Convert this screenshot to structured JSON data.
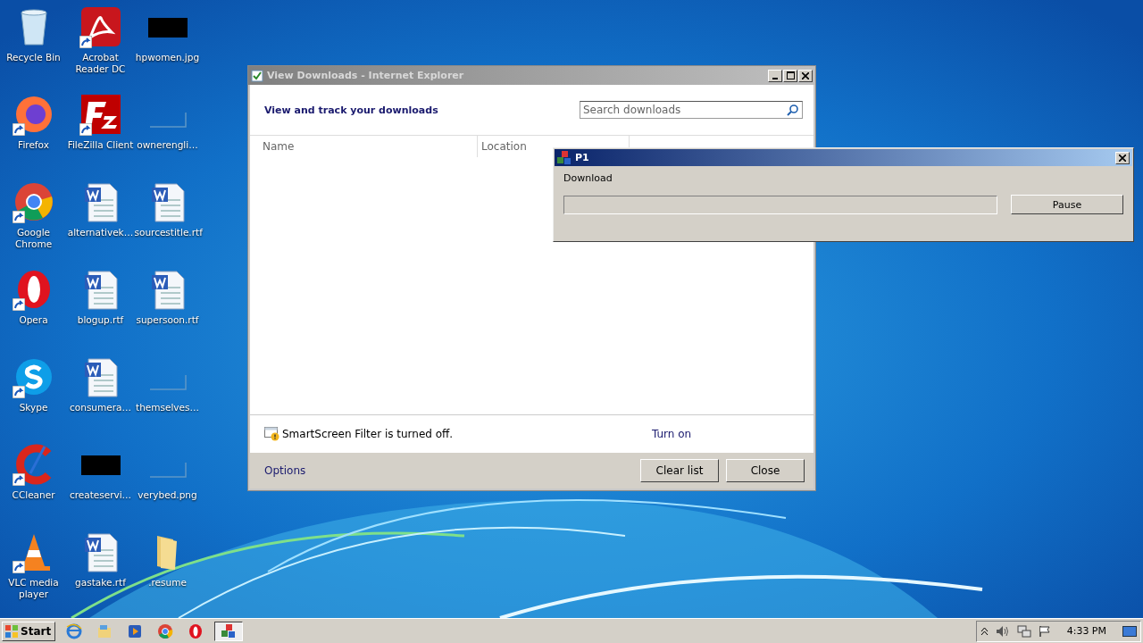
{
  "desktop_icons": [
    {
      "label": "Recycle Bin",
      "kind": "recycle",
      "shortcut": false
    },
    {
      "label": "Acrobat Reader DC",
      "kind": "pdf",
      "shortcut": true
    },
    {
      "label": "hpwomen.jpg",
      "kind": "dark-thumb",
      "shortcut": false
    },
    {
      "label": "Firefox",
      "kind": "firefox",
      "shortcut": true
    },
    {
      "label": "FileZilla Client",
      "kind": "filezilla",
      "shortcut": true
    },
    {
      "label": "ownerengli…",
      "kind": "blank-thumb",
      "shortcut": false
    },
    {
      "label": "Google Chrome",
      "kind": "chrome",
      "shortcut": true
    },
    {
      "label": "alternativek…",
      "kind": "word",
      "shortcut": false
    },
    {
      "label": "sourcestitle.rtf",
      "kind": "word",
      "shortcut": false
    },
    {
      "label": "Opera",
      "kind": "opera",
      "shortcut": true
    },
    {
      "label": "blogup.rtf",
      "kind": "word",
      "shortcut": false
    },
    {
      "label": "supersoon.rtf",
      "kind": "word",
      "shortcut": false
    },
    {
      "label": "Skype",
      "kind": "skype",
      "shortcut": true
    },
    {
      "label": "consumera…",
      "kind": "word",
      "shortcut": false
    },
    {
      "label": "themselves…",
      "kind": "blank-thumb",
      "shortcut": false
    },
    {
      "label": "CCleaner",
      "kind": "ccleaner",
      "shortcut": true
    },
    {
      "label": "createservi…",
      "kind": "dark-thumb",
      "shortcut": false
    },
    {
      "label": "verybed.png",
      "kind": "blank-thumb",
      "shortcut": false
    },
    {
      "label": "VLC media player",
      "kind": "vlc",
      "shortcut": true
    },
    {
      "label": "gastake.rtf",
      "kind": "word",
      "shortcut": false
    },
    {
      "label": ".resume",
      "kind": "folder",
      "shortcut": false
    }
  ],
  "downloads_window": {
    "title": "View Downloads - Internet Explorer",
    "heading": "View and track your downloads",
    "search": {
      "placeholder": "Search downloads"
    },
    "columns": [
      "Name",
      "Location"
    ],
    "smartscreen": {
      "message": "SmartScreen Filter is turned off.",
      "link": "Turn on"
    },
    "options_link": "Options",
    "buttons": [
      "Clear list",
      "Close"
    ]
  },
  "progress_dialog": {
    "title": "P1",
    "label": "Download",
    "progress": {
      "level": 0
    },
    "button": "Pause"
  },
  "taskbar": {
    "start": "Start",
    "apps": [
      {
        "kind": "ie",
        "selected": false
      },
      {
        "kind": "explorer",
        "selected": false
      },
      {
        "kind": "media",
        "selected": false
      },
      {
        "kind": "chrome",
        "selected": false
      },
      {
        "kind": "opera",
        "selected": false
      },
      {
        "kind": "p1",
        "selected": true
      }
    ],
    "clock": "4:33 PM"
  }
}
